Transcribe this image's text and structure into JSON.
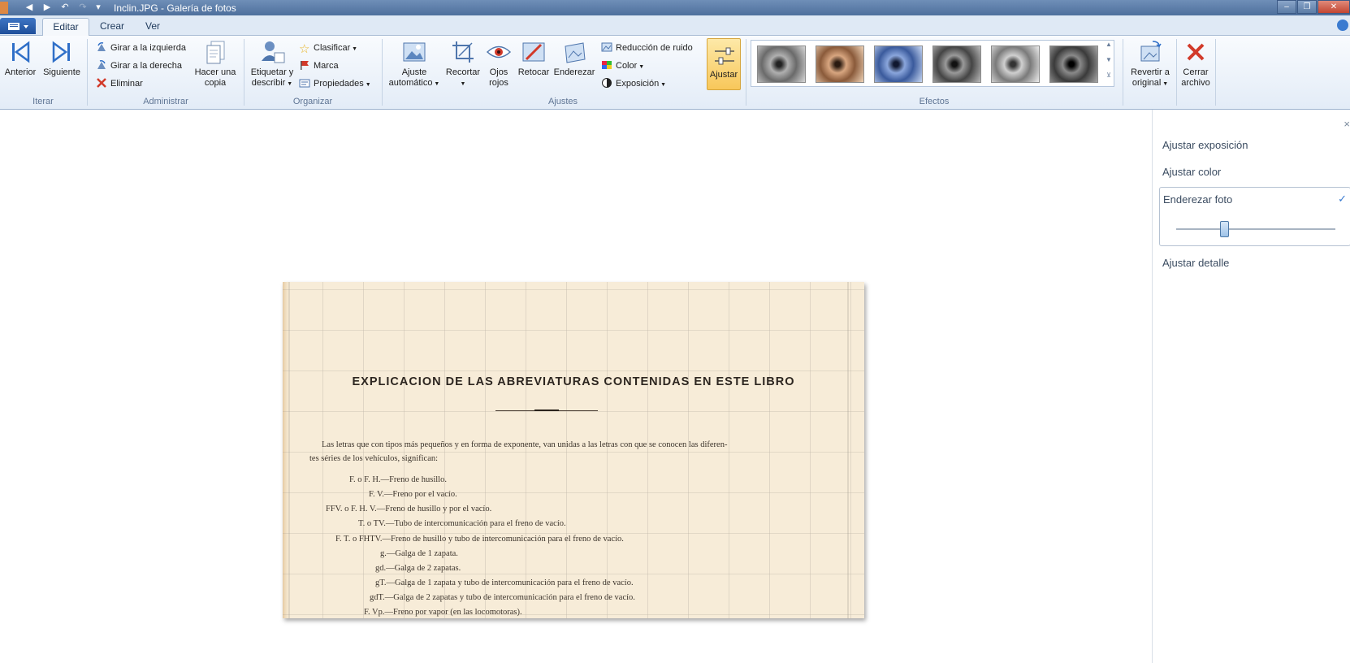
{
  "window": {
    "title": "Inclin.JPG - Galería de fotos",
    "controls": {
      "minimize": "–",
      "maximize": "❐",
      "close": "✕"
    }
  },
  "tabs": [
    {
      "label": "Editar",
      "active": true
    },
    {
      "label": "Crear",
      "active": false
    },
    {
      "label": "Ver",
      "active": false
    }
  ],
  "ribbon": {
    "iterar": {
      "label": "Iterar",
      "anterior": "Anterior",
      "siguiente": "Siguiente"
    },
    "administrar": {
      "label": "Administrar",
      "rotate_left": "Girar a la izquierda",
      "rotate_right": "Girar a la derecha",
      "delete": "Eliminar",
      "copy_line1": "Hacer una",
      "copy_line2": "copia"
    },
    "organizar": {
      "label": "Organizar",
      "tag_line1": "Etiquetar y",
      "tag_line2": "describir",
      "rate": "Clasificar",
      "flag": "Marca",
      "properties": "Propiedades"
    },
    "ajustes": {
      "label": "Ajustes",
      "auto_line1": "Ajuste",
      "auto_line2": "automático",
      "crop": "Recortar",
      "redeye_line1": "Ojos",
      "redeye_line2": "rojos",
      "retouch": "Retocar",
      "straighten": "Enderezar",
      "noise": "Reducción de ruido",
      "color": "Color",
      "exposure": "Exposición",
      "adjust": "Ajustar"
    },
    "efectos": {
      "label": "Efectos"
    },
    "revert": {
      "line1": "Revertir a",
      "line2": "original"
    },
    "close": {
      "line1": "Cerrar",
      "line2": "archivo"
    }
  },
  "document": {
    "title": "EXPLICACION DE LAS ABREVIATURAS CONTENIDAS EN ESTE LIBRO",
    "intro1": "Las letras que con tipos más pequeños y en forma de exponente, van unidas a las letras con que se conocen las diferen-",
    "intro2": "tes séries de los vehículos, significan:",
    "entries": [
      "F. o F. H.—Freno de husillo.",
      "F. V.—Freno por el vacío.",
      "FFV. o F. H. V.—Freno de husillo y por el vacío.",
      "T. o TV.—Tubo de intercomunicación para el freno de vacío.",
      "F. T. o FHTV.—Freno de husillo y tubo de intercomunicación para el freno de vacío.",
      "g.—Galga de 1 zapata.",
      "gd.—Galga de 2 zapatas.",
      "gT.—Galga de 1 zapata y tubo de intercomunicación para el freno de vacío.",
      "gdT.—Galga de 2 zapatas y tubo de intercomunicación para el freno de vacío.",
      "F. Vp.—Freno por vapor (en las locomotoras)."
    ]
  },
  "panel": {
    "close": "×",
    "exposure": "Ajustar exposición",
    "color": "Ajustar color",
    "straighten": "Enderezar foto",
    "check": "✓",
    "straighten_level": 0.3,
    "detail": "Ajustar detalle"
  },
  "colors": {
    "accent": "#3a7bd0",
    "ribbon": "#e3ecf7",
    "active_button": "#f8c75a"
  }
}
